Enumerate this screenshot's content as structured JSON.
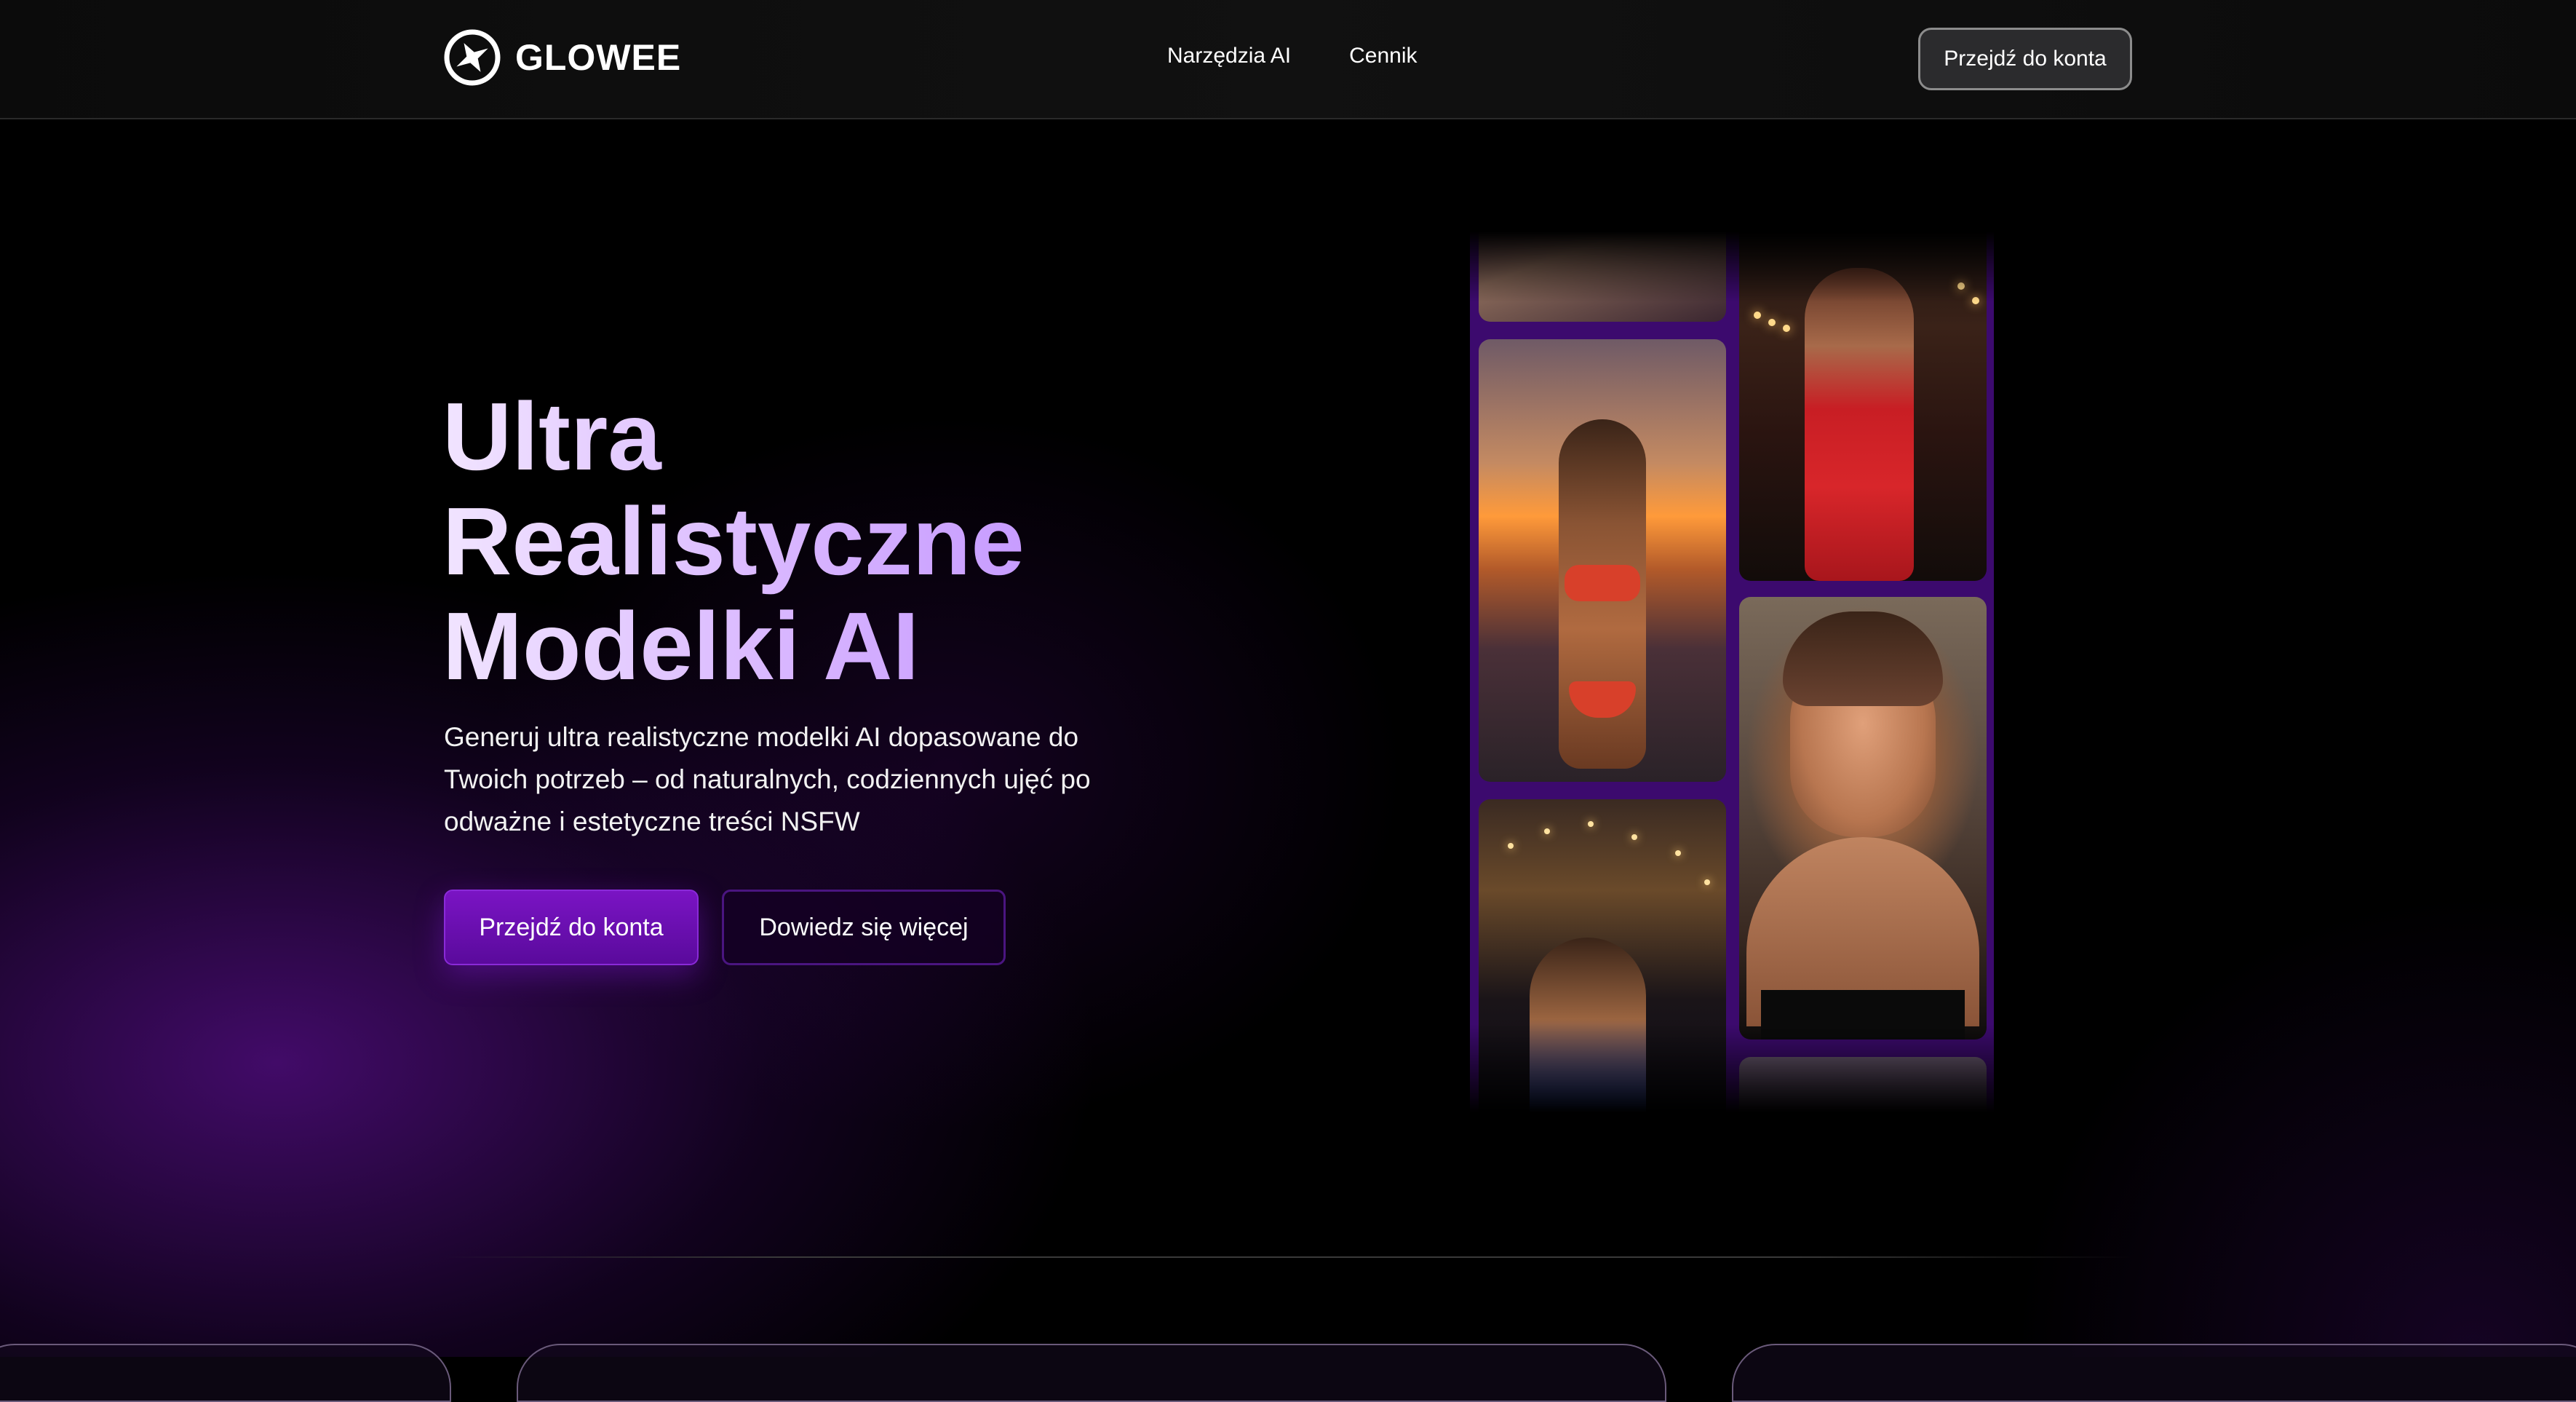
{
  "nav": {
    "brand": "GLOWEE",
    "links": [
      "Narzędzia AI",
      "Cennik"
    ],
    "cta_label": "Przejdź do konta"
  },
  "hero": {
    "title_lines": [
      "Ultra",
      "Realistyczne",
      "Modelki AI"
    ],
    "description": "Generuj ultra realistyczne modelki AI dopasowane do Twoich potrzeb – od naturalnych, codziennych ujęć po odważne i estetyczne treści NSFW",
    "primary_button": "Przejdź do konta",
    "secondary_button": "Dowiedz się więcej"
  },
  "colors": {
    "accent": "#7a14c4",
    "title_gradient_start": "#f1e4ff",
    "title_gradient_end": "#c79cff",
    "gallery_bg": "#3c0a6e"
  },
  "gallery": {
    "photos": [
      "photo-beach-hammock",
      "photo-beach-sunset-bikini",
      "photo-night-pier",
      "photo-red-dress-street",
      "photo-portrait-closeup",
      "photo-partial"
    ]
  }
}
